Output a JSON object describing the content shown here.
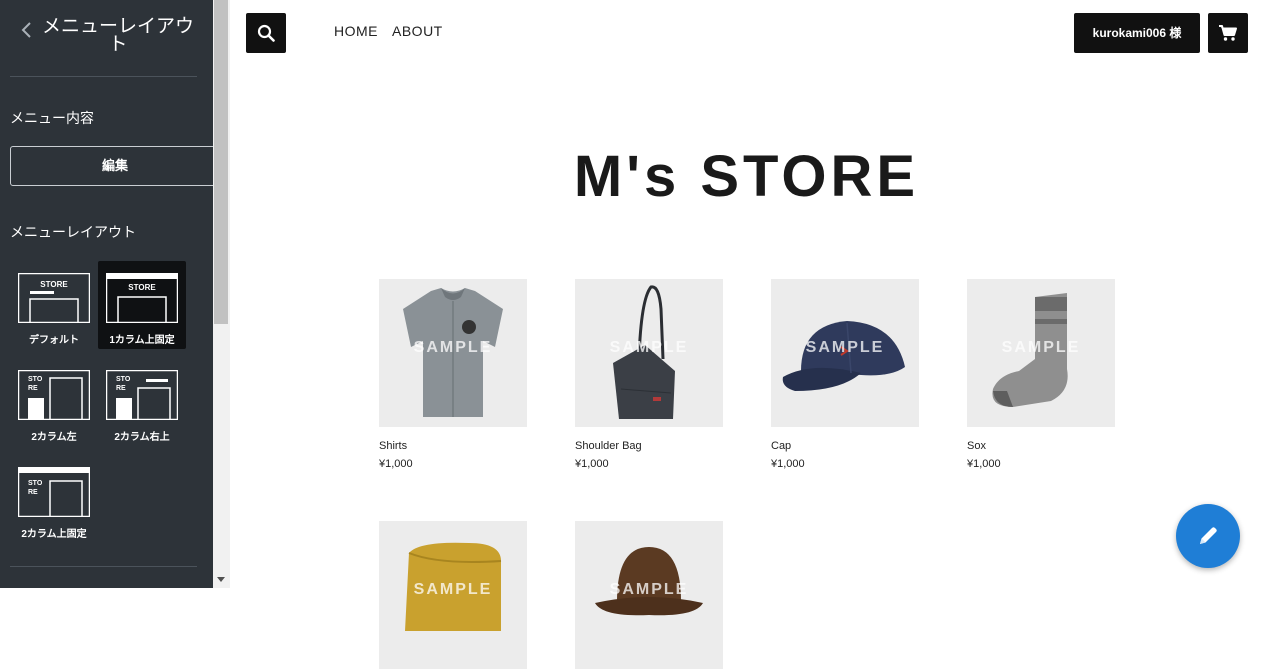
{
  "sidebar": {
    "title": "メニューレイアウト",
    "menu_content_label": "メニュー内容",
    "edit_button_label": "編集",
    "menu_layout_label": "メニューレイアウト",
    "layouts": [
      {
        "label": "デフォルト",
        "thumb_text": "STORE",
        "selected": false
      },
      {
        "label": "1カラム上固定",
        "thumb_text": "STORE",
        "selected": true
      },
      {
        "label": "2カラム左",
        "thumb_text": "STO RE",
        "selected": false
      },
      {
        "label": "2カラム右上",
        "thumb_text": "STO RE",
        "selected": false
      },
      {
        "label": "2カラム上固定",
        "thumb_text": "STO RE",
        "selected": false
      }
    ]
  },
  "header": {
    "nav": [
      "HOME",
      "ABOUT"
    ],
    "user_label": "kurokami006 様",
    "icons": {
      "search": "search-icon",
      "cart": "cart-icon",
      "back": "chevron-left-icon",
      "fab": "pencil-icon"
    }
  },
  "store": {
    "title": "M's STORE",
    "sample_watermark": "SAMPLE",
    "products": [
      {
        "name": "Shirts",
        "price": "¥1,000"
      },
      {
        "name": "Shoulder Bag",
        "price": "¥1,000"
      },
      {
        "name": "Cap",
        "price": "¥1,000"
      },
      {
        "name": "Sox",
        "price": "¥1,000"
      },
      {
        "name": "",
        "price": ""
      },
      {
        "name": "",
        "price": ""
      }
    ]
  },
  "colors": {
    "sidebar_bg": "#2d3339",
    "accent": "#1f7ed6",
    "button_dark": "#111111"
  }
}
